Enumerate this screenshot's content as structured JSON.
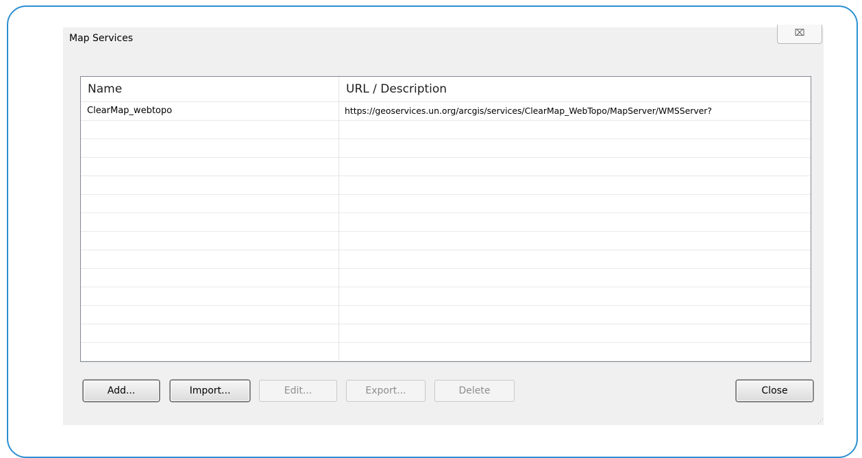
{
  "window": {
    "title": "Map Services",
    "close_glyph": "⌧"
  },
  "table": {
    "headers": [
      "Name",
      "URL / Description"
    ],
    "rows": [
      {
        "name": "ClearMap_webtopo",
        "url": "https://geoservices.un.org/arcgis/services/ClearMap_WebTopo/MapServer/WMSServer?"
      }
    ],
    "empty_row_count": 12
  },
  "buttons": {
    "add": "Add...",
    "import": "Import...",
    "edit": "Edit...",
    "export": "Export...",
    "delete": "Delete",
    "close": "Close"
  },
  "colors": {
    "frame_border": "#2b8fd2",
    "dialog_bg": "#f0f0f0",
    "disabled_text": "#8d8d8d"
  }
}
